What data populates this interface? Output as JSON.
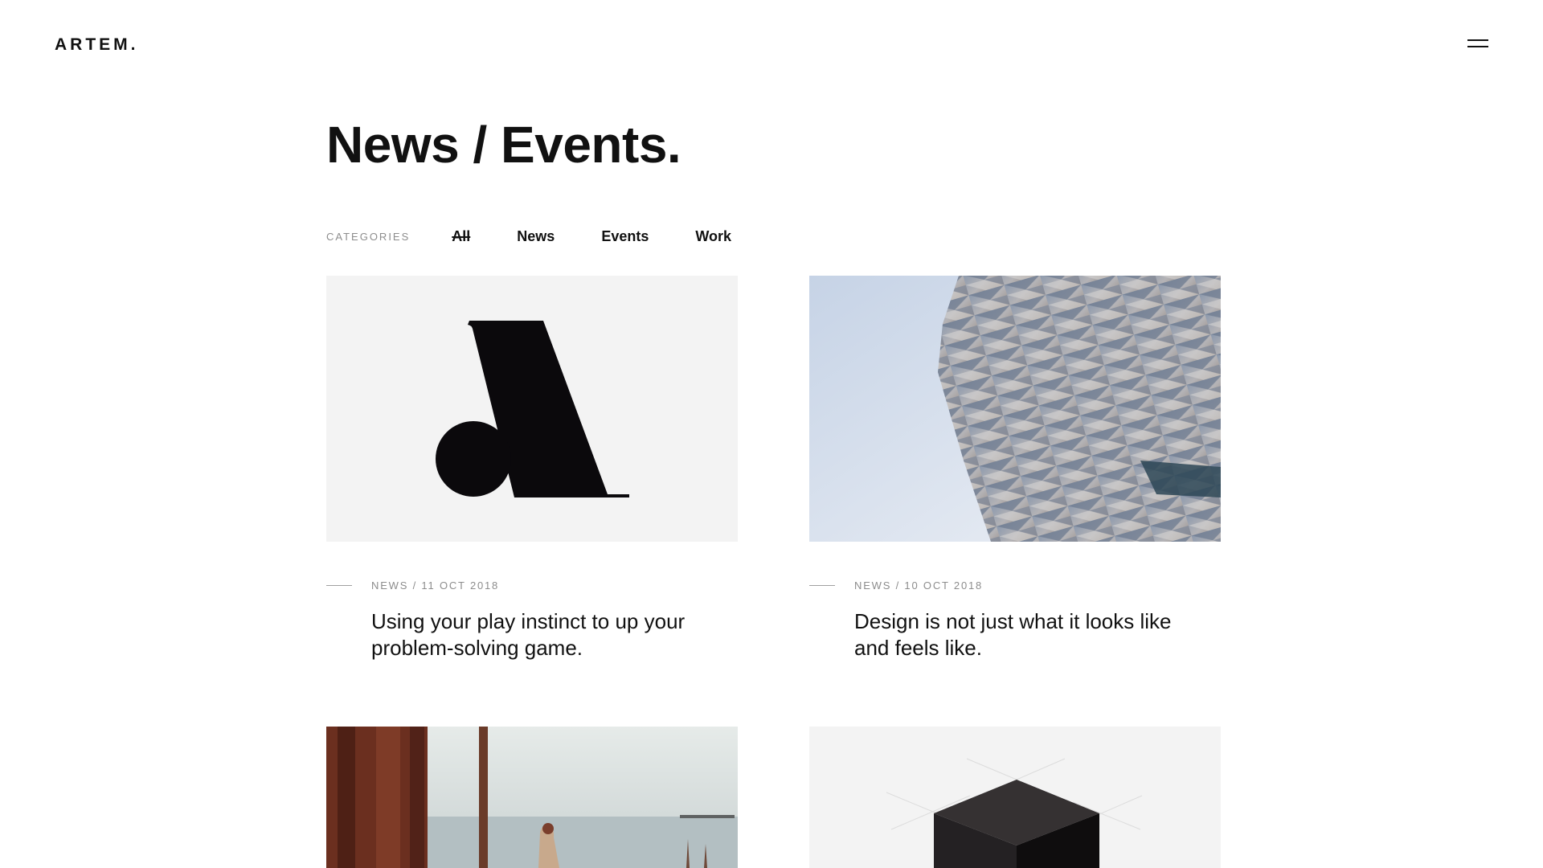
{
  "brand": {
    "logo": "ARTEM."
  },
  "header": {
    "menu_icon": "hamburger-menu-icon"
  },
  "page": {
    "title": "News / Events."
  },
  "filters": {
    "label": "CATEGORIES",
    "items": [
      {
        "label": "All",
        "active": true
      },
      {
        "label": "News",
        "active": false
      },
      {
        "label": "Events",
        "active": false
      },
      {
        "label": "Work",
        "active": false
      }
    ]
  },
  "posts": [
    {
      "meta": "NEWS / 11 OCT 2018",
      "title": "Using your play instinct to up your problem-solving game.",
      "image": "artem-logo-mark-image"
    },
    {
      "meta": "NEWS / 10 OCT 2018",
      "title": "Design is not just what it looks like and feels like.",
      "image": "architecture-facade-image"
    },
    {
      "image": "forest-lake-person-image"
    },
    {
      "image": "black-cube-image"
    }
  ],
  "colors": {
    "text": "#111111",
    "muted": "#8d8d8d",
    "thumb_bg": "#f3f3f3"
  }
}
